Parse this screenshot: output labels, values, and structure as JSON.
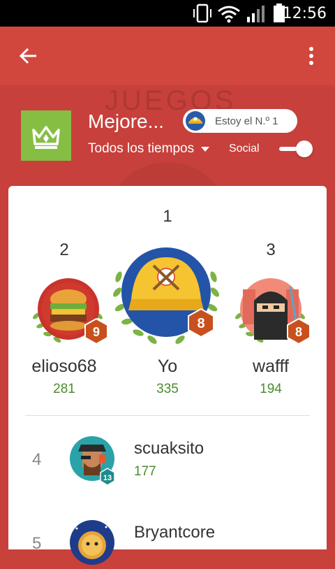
{
  "status_bar": {
    "time": "12:56"
  },
  "app_bar": {
    "back_icon": "arrow-left-icon",
    "menu_icon": "more-vert-icon"
  },
  "background": {
    "watermark_text": "JUEGOS"
  },
  "header": {
    "title": "Mejore...",
    "time_filter": "Todos los tiempos",
    "pill_label": "Estoy el N.º 1",
    "social_label": "Social",
    "social_toggle": true
  },
  "podium": [
    {
      "rank": "2",
      "name": "elioso68",
      "score": "281",
      "level": "9"
    },
    {
      "rank": "1",
      "name": "Yo",
      "score": "335",
      "level": "8"
    },
    {
      "rank": "3",
      "name": "wafff",
      "score": "194",
      "level": "8"
    }
  ],
  "list": [
    {
      "rank": "4",
      "name": "scuaksito",
      "score": "177",
      "level": "13"
    },
    {
      "rank": "5",
      "name": "Bryantcore",
      "score": "",
      "level": ""
    }
  ],
  "colors": {
    "appbar": "#d1473d",
    "background": "#c7403b",
    "accent_green": "#86be44",
    "score_green": "#4b8b2e",
    "hex_badge": "#c8501d"
  }
}
